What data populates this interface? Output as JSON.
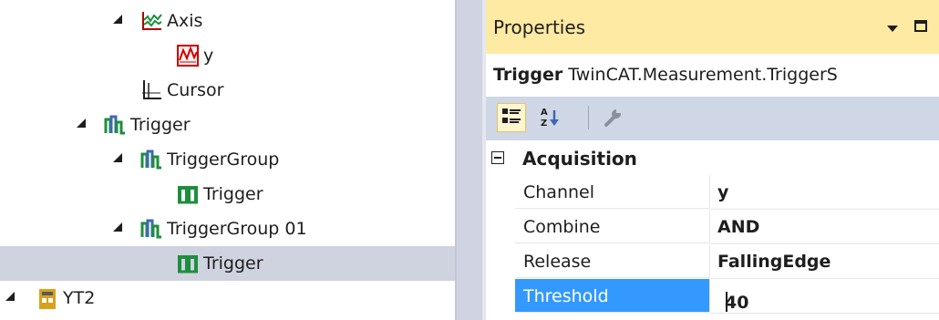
{
  "tree": {
    "nodes": [
      {
        "label": "Axis",
        "icon": "axis-chart-icon"
      },
      {
        "label": "y",
        "icon": "chart-channel-icon"
      },
      {
        "label": "Cursor",
        "icon": "cursor-axis-icon"
      },
      {
        "label": "Trigger",
        "icon": "trigger-folder-icon"
      },
      {
        "label": "TriggerGroup",
        "icon": "trigger-group-icon"
      },
      {
        "label": "Trigger",
        "icon": "trigger-icon"
      },
      {
        "label": "TriggerGroup 01",
        "icon": "trigger-group-icon"
      },
      {
        "label": "Trigger",
        "icon": "trigger-icon",
        "selected": true
      },
      {
        "label": "YT2",
        "icon": "project-icon"
      }
    ]
  },
  "properties": {
    "title": "Properties",
    "object_name": "Trigger",
    "object_type": "TwinCAT.Measurement.TriggerS",
    "category": "Acquisition",
    "rows": [
      {
        "name": "Channel",
        "value": "y"
      },
      {
        "name": "Combine",
        "value": "AND"
      },
      {
        "name": "Release",
        "value": "FallingEdge"
      },
      {
        "name": "Threshold",
        "value": "40"
      }
    ]
  },
  "colors": {
    "title_bar": "#ffeaa3",
    "selection": "#cfd3e0",
    "editing_highlight": "#3399ff",
    "trigger_green": "#1e8e3e"
  }
}
